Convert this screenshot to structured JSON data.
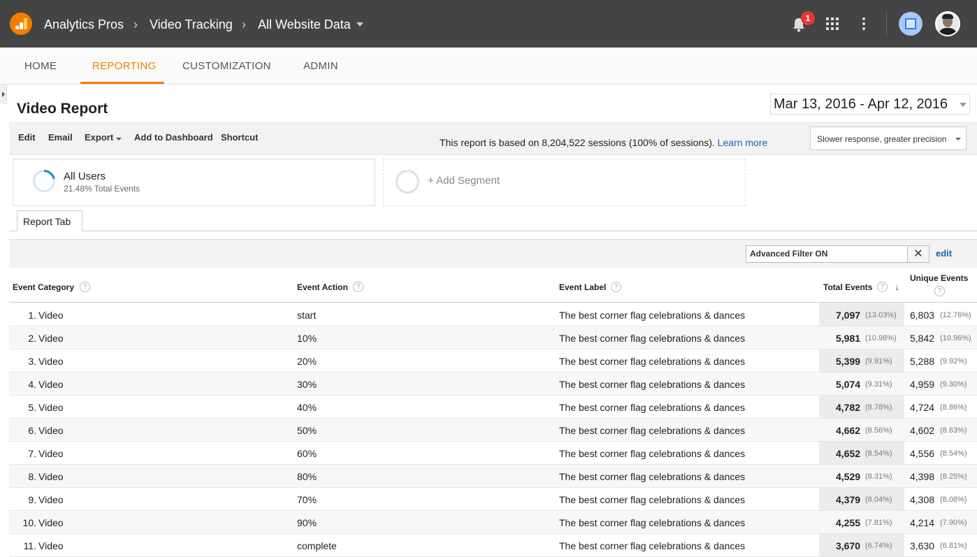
{
  "header": {
    "breadcrumb": [
      "Analytics Pros",
      "Video Tracking",
      "All Website Data"
    ],
    "notification_count": "1"
  },
  "nav": [
    "HOME",
    "REPORTING",
    "CUSTOMIZATION",
    "ADMIN"
  ],
  "page": {
    "title": "Video Report",
    "date_range": "Mar 13, 2016 - Apr 12, 2016"
  },
  "toolbar": {
    "edit": "Edit",
    "email": "Email",
    "export": "Export",
    "add_to_dashboard": "Add to Dashboard",
    "shortcut": "Shortcut",
    "sessions_text": "This report is based on 8,204,522 sessions (100% of sessions).",
    "learn_more": "Learn more",
    "sampling": "Slower response, greater precision"
  },
  "segments": {
    "primary_name": "All Users",
    "primary_sub": "21.48% Total Events",
    "primary_share": 0.2148,
    "add_segment": "+ Add Segment"
  },
  "report_tab": "Report Tab",
  "filter": {
    "value": "Advanced Filter ON",
    "clear": "✕",
    "edit": "edit"
  },
  "table": {
    "columns": {
      "category": "Event Category",
      "action": "Event Action",
      "label": "Event Label",
      "total": "Total Events",
      "unique": "Unique Events"
    },
    "rows": [
      {
        "n": "1.",
        "category": "Video",
        "action": "start",
        "label": "The best corner flag celebrations & dances",
        "total": "7,097",
        "total_pct": "(13.03%)",
        "unique": "6,803",
        "unique_pct": "(12.76%)"
      },
      {
        "n": "2.",
        "category": "Video",
        "action": "10%",
        "label": "The best corner flag celebrations & dances",
        "total": "5,981",
        "total_pct": "(10.98%)",
        "unique": "5,842",
        "unique_pct": "(10.96%)"
      },
      {
        "n": "3.",
        "category": "Video",
        "action": "20%",
        "label": "The best corner flag celebrations & dances",
        "total": "5,399",
        "total_pct": "(9.91%)",
        "unique": "5,288",
        "unique_pct": "(9.92%)"
      },
      {
        "n": "4.",
        "category": "Video",
        "action": "30%",
        "label": "The best corner flag celebrations & dances",
        "total": "5,074",
        "total_pct": "(9.31%)",
        "unique": "4,959",
        "unique_pct": "(9.30%)"
      },
      {
        "n": "5.",
        "category": "Video",
        "action": "40%",
        "label": "The best corner flag celebrations & dances",
        "total": "4,782",
        "total_pct": "(8.78%)",
        "unique": "4,724",
        "unique_pct": "(8.86%)"
      },
      {
        "n": "6.",
        "category": "Video",
        "action": "50%",
        "label": "The best corner flag celebrations & dances",
        "total": "4,662",
        "total_pct": "(8.56%)",
        "unique": "4,602",
        "unique_pct": "(8.63%)"
      },
      {
        "n": "7.",
        "category": "Video",
        "action": "60%",
        "label": "The best corner flag celebrations & dances",
        "total": "4,652",
        "total_pct": "(8.54%)",
        "unique": "4,556",
        "unique_pct": "(8.54%)"
      },
      {
        "n": "8.",
        "category": "Video",
        "action": "80%",
        "label": "The best corner flag celebrations & dances",
        "total": "4,529",
        "total_pct": "(8.31%)",
        "unique": "4,398",
        "unique_pct": "(8.25%)"
      },
      {
        "n": "9.",
        "category": "Video",
        "action": "70%",
        "label": "The best corner flag celebrations & dances",
        "total": "4,379",
        "total_pct": "(8.04%)",
        "unique": "4,308",
        "unique_pct": "(8.08%)"
      },
      {
        "n": "10.",
        "category": "Video",
        "action": "90%",
        "label": "The best corner flag celebrations & dances",
        "total": "4,255",
        "total_pct": "(7.81%)",
        "unique": "4,214",
        "unique_pct": "(7.90%)"
      },
      {
        "n": "11.",
        "category": "Video",
        "action": "complete",
        "label": "The best corner flag celebrations & dances",
        "total": "3,670",
        "total_pct": "(6.74%)",
        "unique": "3,630",
        "unique_pct": "(6.81%)"
      }
    ]
  },
  "colors": {
    "topbar": "#444444",
    "accent": "#f57c00",
    "link": "#1565c0",
    "notification": "#e53935"
  }
}
